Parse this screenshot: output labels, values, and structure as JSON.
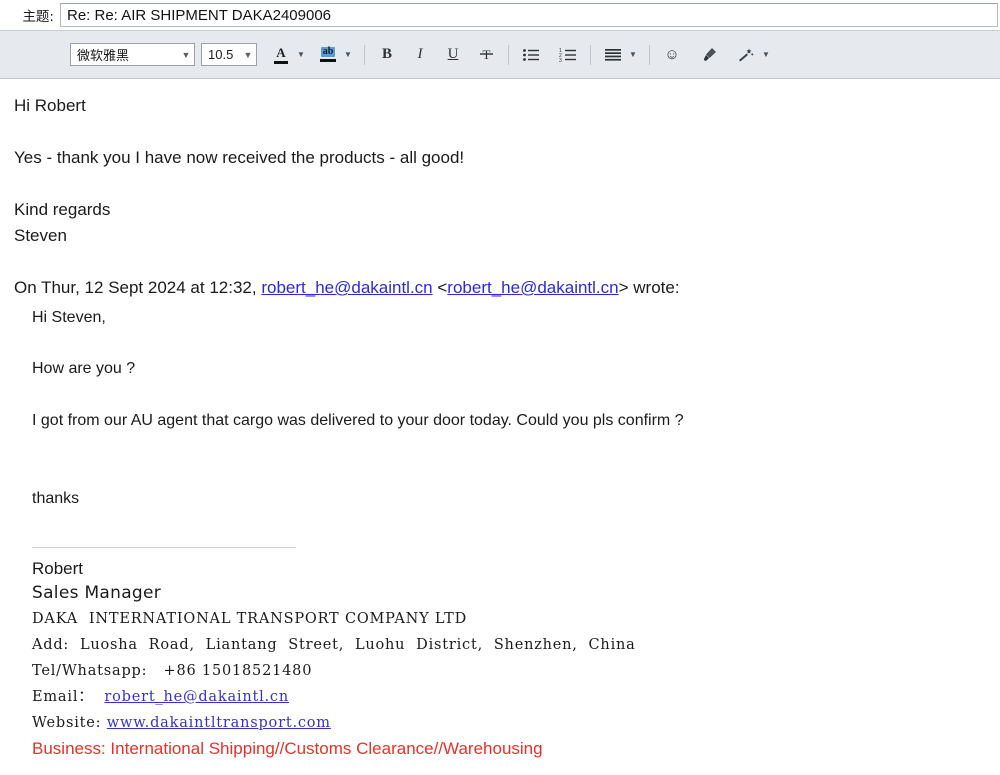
{
  "subject": {
    "label": "主题:",
    "value": "Re: Re: AIR SHIPMENT DAKA2409006",
    "placeholder": "主题"
  },
  "toolbar": {
    "font_family": "微软雅黑",
    "font_size": "10.5",
    "buttons": {
      "font_color": "A",
      "highlight": "ab",
      "bold": "B",
      "italic": "I",
      "underline": "U",
      "strikethrough": "strikethrough-icon",
      "bullet_list": "bullet-list-icon",
      "numbered_list": "numbered-list-icon",
      "align": "align-icon",
      "emoji": "☺",
      "format_painter": "brush-icon",
      "magic": "magic-wand-icon"
    }
  },
  "message": {
    "greeting": "Hi Robert",
    "line1": "Yes - thank you I have now received the products - all good!",
    "signoff": "Kind regards",
    "sender": "Steven"
  },
  "reply_header": {
    "prefix": "On Thur, 12 Sept 2024 at 12:32, ",
    "link1": "robert_he@dakaintl.cn",
    "mid_open": " <",
    "link2": "robert_he@dakaintl.cn",
    "mid_close": "> ",
    "suffix": "wrote:"
  },
  "quoted": {
    "greeting": "Hi Steven,",
    "line1": "How are you ?",
    "line2": "I got from our AU agent that cargo was delivered to your door today. Could you pls confirm ?",
    "thanks": "thanks",
    "signature": {
      "name": "Robert",
      "title": "Sales Manager",
      "company": "DAKA  INTERNATIONAL TRANSPORT COMPANY LTD",
      "address": "Add:  Luosha  Road,  Liantang  Street,  Luohu  District,  Shenzhen,  China",
      "tel": "Tel/Whatsapp:   +86 15018521480",
      "email_label": "Email：  ",
      "email_value": "robert_he@dakaintl.cn",
      "website_label": "Website: ",
      "website_value": "www.dakaintltransport.com",
      "business": "Business: International Shipping//Customs Clearance//Warehousing"
    }
  },
  "colors": {
    "link": "#2b2bd6",
    "business_red": "#e8302a",
    "toolbar_bg": "#e6eaee",
    "highlight_blue": "#5b9bd5"
  }
}
